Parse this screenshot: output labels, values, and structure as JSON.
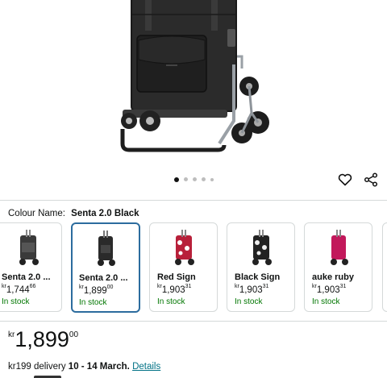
{
  "gallery": {
    "image_count": 5,
    "active_index": 0
  },
  "colour": {
    "label": "Colour Name:",
    "selected": "Senta 2.0 Black"
  },
  "swatches": [
    {
      "name": "Senta 2.0 ...",
      "currency": "kr",
      "whole": "1,744",
      "fraction": "66",
      "stock": "In stock",
      "color": "#3a3a3a"
    },
    {
      "name": "Senta 2.0 ...",
      "currency": "kr",
      "whole": "1,899",
      "fraction": "00",
      "stock": "In stock",
      "color": "#2a2a2a"
    },
    {
      "name": "Red Sign",
      "currency": "kr",
      "whole": "1,903",
      "fraction": "31",
      "stock": "In stock",
      "color": "#b8203a"
    },
    {
      "name": "Black Sign",
      "currency": "kr",
      "whole": "1,903",
      "fraction": "31",
      "stock": "In stock",
      "color": "#222222"
    },
    {
      "name": "auke ruby",
      "currency": "kr",
      "whole": "1,903",
      "fraction": "31",
      "stock": "In stock",
      "color": "#c2185b"
    }
  ],
  "price": {
    "currency": "kr",
    "whole": "1,899",
    "fraction": "00"
  },
  "delivery": {
    "fee": "kr199 delivery",
    "dates": "10 - 14 March.",
    "link": "Details"
  },
  "colors": {
    "accent_link": "#007185",
    "in_stock": "#007600",
    "selected_border": "#2c6c9e"
  }
}
